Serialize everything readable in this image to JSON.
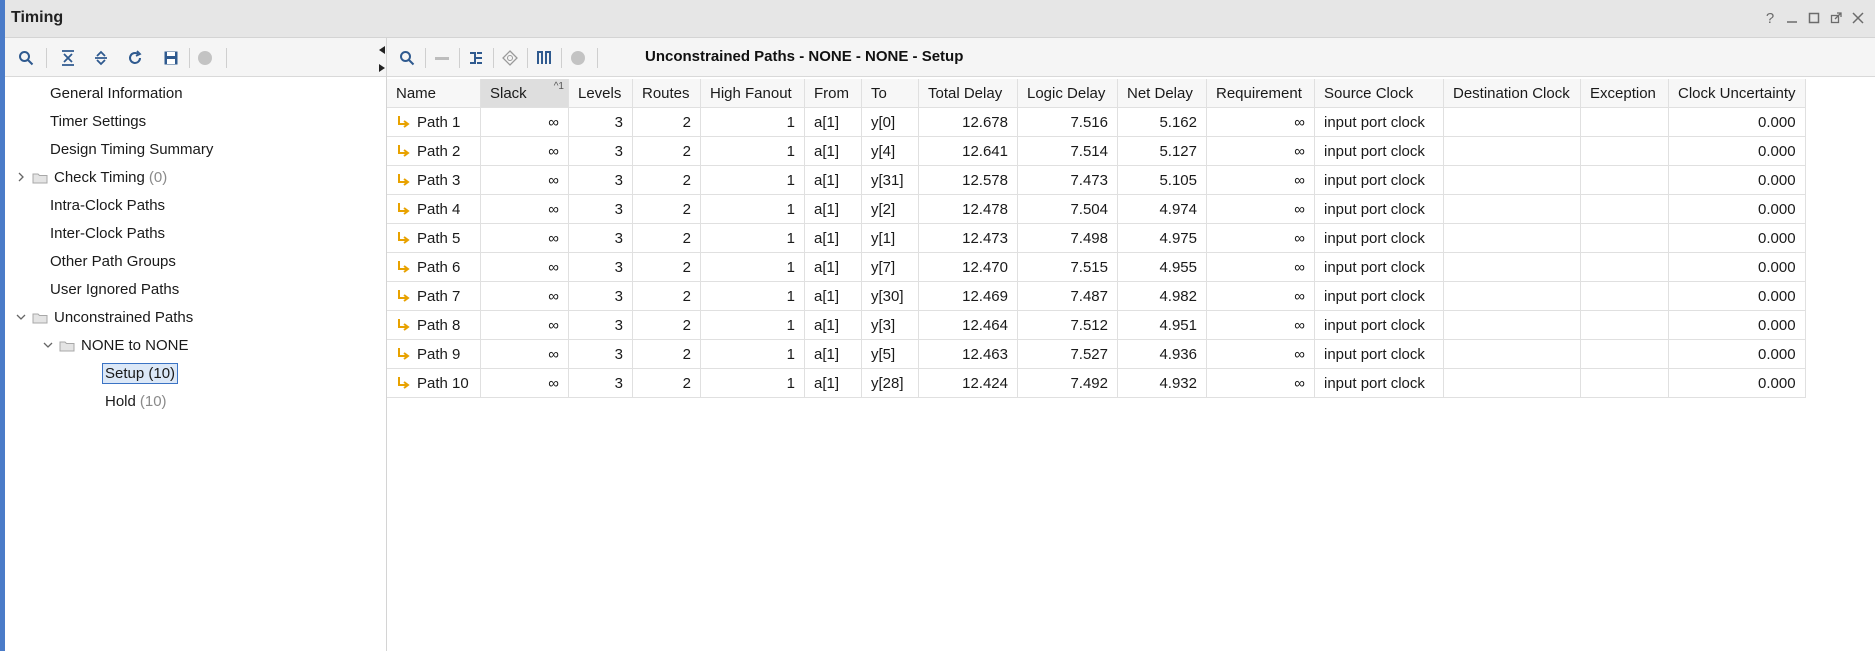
{
  "window": {
    "title": "Timing"
  },
  "titlebar_controls": [
    "help-icon",
    "minimize-icon",
    "restore-icon",
    "float-icon",
    "close-icon"
  ],
  "left_toolbar": {
    "icons": [
      "search-icon",
      "collapse-all-icon",
      "expand-all-icon",
      "refresh-icon",
      "save-icon",
      "stop-icon"
    ]
  },
  "tree": {
    "general_information": "General Information",
    "timer_settings": "Timer Settings",
    "design_timing_summary": "Design Timing Summary",
    "check_timing": {
      "label": "Check Timing",
      "count": "(0)"
    },
    "intra_clock_paths": "Intra-Clock Paths",
    "inter_clock_paths": "Inter-Clock Paths",
    "other_path_groups": "Other Path Groups",
    "user_ignored_paths": "User Ignored Paths",
    "unconstrained_paths": "Unconstrained Paths",
    "none_to_none": "NONE to NONE",
    "setup": "Setup (10)",
    "hold": {
      "label": "Hold",
      "count": "(10)"
    }
  },
  "right_toolbar": {
    "icons": [
      "search-icon",
      "minus-icon",
      "schematic-icon",
      "highlight-icon",
      "columns-icon",
      "stop-icon"
    ],
    "title": "Unconstrained Paths - NONE - NONE - Setup"
  },
  "table": {
    "sort_indicator": "^1",
    "columns": [
      "Name",
      "Slack",
      "Levels",
      "Routes",
      "High Fanout",
      "From",
      "To",
      "Total Delay",
      "Logic Delay",
      "Net Delay",
      "Requirement",
      "Source Clock",
      "Destination Clock",
      "Exception",
      "Clock Uncertainty"
    ],
    "rows": [
      {
        "name": "Path 1",
        "slack": "∞",
        "levels": "3",
        "routes": "2",
        "fanout": "1",
        "from": "a[1]",
        "to": "y[0]",
        "total": "12.678",
        "logic": "7.516",
        "net": "5.162",
        "req": "∞",
        "src": "input port clock",
        "dst": "",
        "exc": "",
        "unc": "0.000"
      },
      {
        "name": "Path 2",
        "slack": "∞",
        "levels": "3",
        "routes": "2",
        "fanout": "1",
        "from": "a[1]",
        "to": "y[4]",
        "total": "12.641",
        "logic": "7.514",
        "net": "5.127",
        "req": "∞",
        "src": "input port clock",
        "dst": "",
        "exc": "",
        "unc": "0.000"
      },
      {
        "name": "Path 3",
        "slack": "∞",
        "levels": "3",
        "routes": "2",
        "fanout": "1",
        "from": "a[1]",
        "to": "y[31]",
        "total": "12.578",
        "logic": "7.473",
        "net": "5.105",
        "req": "∞",
        "src": "input port clock",
        "dst": "",
        "exc": "",
        "unc": "0.000"
      },
      {
        "name": "Path 4",
        "slack": "∞",
        "levels": "3",
        "routes": "2",
        "fanout": "1",
        "from": "a[1]",
        "to": "y[2]",
        "total": "12.478",
        "logic": "7.504",
        "net": "4.974",
        "req": "∞",
        "src": "input port clock",
        "dst": "",
        "exc": "",
        "unc": "0.000"
      },
      {
        "name": "Path 5",
        "slack": "∞",
        "levels": "3",
        "routes": "2",
        "fanout": "1",
        "from": "a[1]",
        "to": "y[1]",
        "total": "12.473",
        "logic": "7.498",
        "net": "4.975",
        "req": "∞",
        "src": "input port clock",
        "dst": "",
        "exc": "",
        "unc": "0.000"
      },
      {
        "name": "Path 6",
        "slack": "∞",
        "levels": "3",
        "routes": "2",
        "fanout": "1",
        "from": "a[1]",
        "to": "y[7]",
        "total": "12.470",
        "logic": "7.515",
        "net": "4.955",
        "req": "∞",
        "src": "input port clock",
        "dst": "",
        "exc": "",
        "unc": "0.000"
      },
      {
        "name": "Path 7",
        "slack": "∞",
        "levels": "3",
        "routes": "2",
        "fanout": "1",
        "from": "a[1]",
        "to": "y[30]",
        "total": "12.469",
        "logic": "7.487",
        "net": "4.982",
        "req": "∞",
        "src": "input port clock",
        "dst": "",
        "exc": "",
        "unc": "0.000"
      },
      {
        "name": "Path 8",
        "slack": "∞",
        "levels": "3",
        "routes": "2",
        "fanout": "1",
        "from": "a[1]",
        "to": "y[3]",
        "total": "12.464",
        "logic": "7.512",
        "net": "4.951",
        "req": "∞",
        "src": "input port clock",
        "dst": "",
        "exc": "",
        "unc": "0.000"
      },
      {
        "name": "Path 9",
        "slack": "∞",
        "levels": "3",
        "routes": "2",
        "fanout": "1",
        "from": "a[1]",
        "to": "y[5]",
        "total": "12.463",
        "logic": "7.527",
        "net": "4.936",
        "req": "∞",
        "src": "input port clock",
        "dst": "",
        "exc": "",
        "unc": "0.000"
      },
      {
        "name": "Path 10",
        "slack": "∞",
        "levels": "3",
        "routes": "2",
        "fanout": "1",
        "from": "a[1]",
        "to": "y[28]",
        "total": "12.424",
        "logic": "7.492",
        "net": "4.932",
        "req": "∞",
        "src": "input port clock",
        "dst": "",
        "exc": "",
        "unc": "0.000"
      }
    ]
  },
  "colors": {
    "accent": "#4a7bc8",
    "path_icon": "#e8a200",
    "selection": "#dce8f7",
    "toolbar_icon": "#2f5a8f"
  }
}
